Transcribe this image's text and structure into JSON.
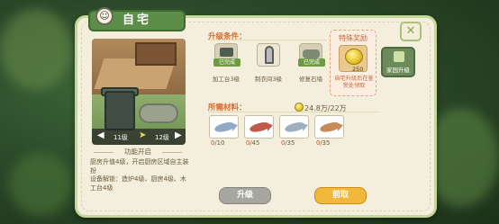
{
  "header": {
    "title": "自宅",
    "face_glyph": "☺"
  },
  "preview": {
    "level_from": "11级",
    "level_to": "12级",
    "arrow": "➤",
    "prev_glyph": "◀",
    "next_glyph": "▶"
  },
  "feature": {
    "title": "功能开启",
    "desc": "厨房升值4级，开启厨房区域自主装扮\n设备解锁：造炉4级、厨房4级、木工台4级"
  },
  "conditions": {
    "title": "升级条件：",
    "items": [
      {
        "label": "加工台3级",
        "status": "已完成",
        "icon": "workbench-icon"
      },
      {
        "label": "制衣间3级",
        "status": "",
        "icon": "mirror-icon"
      },
      {
        "label": "修复石墙",
        "status": "已完成",
        "icon": "stone-wall-icon"
      }
    ]
  },
  "reward": {
    "title": "特殊奖励",
    "amount": "250",
    "note": "自宅升级后在鉴赏处领取",
    "icon": "gold-coin-icon"
  },
  "side_tab": {
    "label": "家园升级",
    "icon": "home-upgrade-icon"
  },
  "close": {
    "glyph": "✕"
  },
  "materials": {
    "title": "所需材料：",
    "money": "24.8万/22万",
    "items": [
      {
        "have": "0",
        "need": "/10",
        "fish_color": "#8fa8c4",
        "icon": "fish-icon"
      },
      {
        "have": "0",
        "need": "/45",
        "fish_color": "#c05a4a",
        "icon": "fish-icon"
      },
      {
        "have": "0",
        "need": "/35",
        "fish_color": "#9db0c0",
        "icon": "fish-icon"
      },
      {
        "have": "0",
        "need": "/35",
        "fish_color": "#c98a5a",
        "icon": "fish-icon"
      }
    ]
  },
  "buttons": {
    "upgrade": "升级",
    "claim": "前取"
  },
  "colors": {
    "accent": "#d9692c",
    "panel_bg": "#f4efdc",
    "green": "#6f9c43",
    "gold": "#f2b83a"
  }
}
